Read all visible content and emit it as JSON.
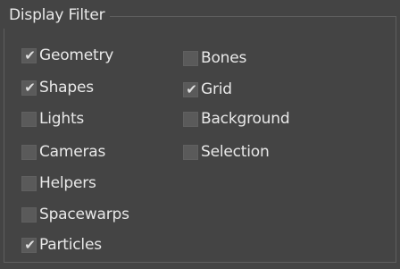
{
  "panel": {
    "title": "Display Filter",
    "options": [
      {
        "label": "Geometry",
        "checked": true,
        "check_glyph": "✔"
      },
      {
        "label": "Shapes",
        "checked": true,
        "check_glyph": "✔"
      },
      {
        "label": "Lights",
        "checked": false,
        "check_glyph": ""
      },
      {
        "label": "Cameras",
        "checked": false,
        "check_glyph": ""
      },
      {
        "label": "Helpers",
        "checked": false,
        "check_glyph": ""
      },
      {
        "label": "Spacewarps",
        "checked": false,
        "check_glyph": ""
      },
      {
        "label": "Particles",
        "checked": true,
        "check_glyph": "✔"
      },
      {
        "label": "Bones",
        "checked": false,
        "check_glyph": ""
      },
      {
        "label": "Grid",
        "checked": true,
        "check_glyph": "✔"
      },
      {
        "label": "Background",
        "checked": false,
        "check_glyph": ""
      },
      {
        "label": "Selection",
        "checked": false,
        "check_glyph": ""
      }
    ]
  },
  "colors": {
    "panel_background": "#444444",
    "text": "#e8e8e8",
    "checkbox_fill": "#5a5a5a",
    "checkmark": "#dedede",
    "frame_border": "#5f5f5f"
  }
}
